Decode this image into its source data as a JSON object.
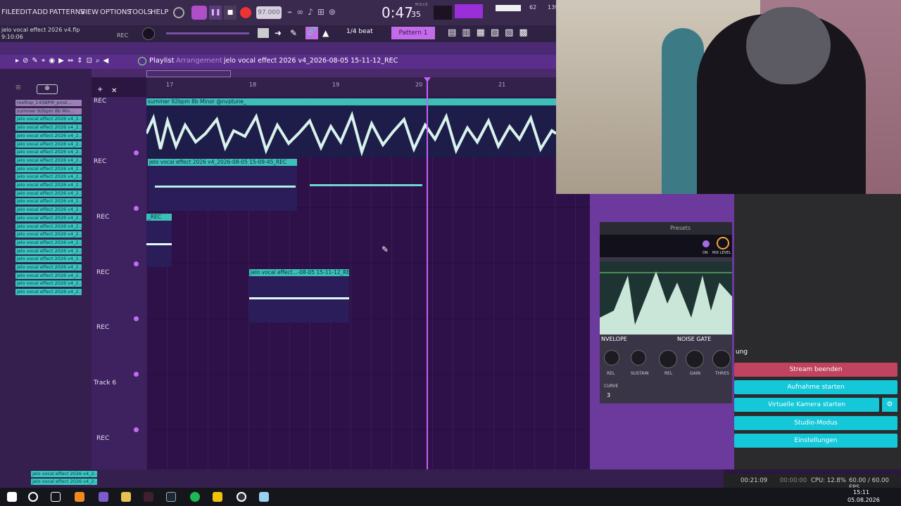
{
  "menu": [
    "FILE",
    "EDIT",
    "ADD",
    "PATTERNS",
    "VIEW",
    "OPTIONS",
    "TOOLS",
    "HELP"
  ],
  "transport": {
    "tempo": "97.000",
    "time": "0:47",
    "time_small": "35",
    "time_unit": "M:S:CS",
    "cpu_value": "62",
    "ram_value": "139"
  },
  "project": {
    "name": "jelo vocal effect 2026 v4.flp",
    "time": "9:10:06",
    "rec": "REC"
  },
  "snap": {
    "value": "1/4 beat",
    "pattern": "Pattern 1"
  },
  "playlist": {
    "title": "Playlist",
    "subtitle": "Arrangement",
    "clip_name": "jelo vocal effect 2026 v4_2026-08-05 15-11-12_REC"
  },
  "ruler": [
    "17",
    "18",
    "19",
    "20",
    "21"
  ],
  "patterns": [
    "rooftop_145BPM_prod...",
    "summer 92bpm 8b Min...",
    "jelo vocal effect 2026 v4_2...",
    "jelo vocal effect 2026 v4_2...",
    "jelo vocal effect 2026 v4_2...",
    "jelo vocal effect 2026 v4_2...",
    "jelo vocal effect 2026 v4_2...",
    "jelo vocal effect 2026 v4_2...",
    "jelo vocal effect 2026 v4_2...",
    "jelo vocal effect 2026 v4_2...",
    "jelo vocal effect 2026 v4_2...",
    "jelo vocal effect 2026 v4_2...",
    "jelo vocal effect 2026 v4_2...",
    "jelo vocal effect 2026 v4_2...",
    "jelo vocal effect 2026 v4_2...",
    "jelo vocal effect 2026 v4_2...",
    "jelo vocal effect 2026 v4_2...",
    "jelo vocal effect 2026 v4_2...",
    "jelo vocal effect 2026 v4_2...",
    "jelo vocal effect 2026 v4_2...",
    "jelo vocal effect 2026 v4_2...",
    "jelo vocal effect 2026 v4_2...",
    "jelo vocal effect 2026 v4_2...",
    "jelo vocal effect 2026 v4_2..."
  ],
  "tracks": [
    "REC",
    "REC",
    "REC",
    "REC",
    "REC",
    "Track 6",
    "REC"
  ],
  "clips": {
    "c1": "summer 92bpm 8b Minor @nvptune_",
    "c2": "jelo vocal effect 2026 v4_2026-08-05 15-09-45_REC",
    "c3": "_REC",
    "c4": "jelo vocal effect...-08-05 15-11-12_REC"
  },
  "plugin": {
    "presets": "Presets",
    "on": "ON",
    "mix": "MIX LEVEL",
    "envelope": "NVELOPE",
    "noise_gate": "NOISE GATE",
    "knobs": [
      "REL",
      "SUSTAIN",
      "REL",
      "GAIN",
      "THRES"
    ],
    "curve": "CURVE",
    "curve_val": "3"
  },
  "obs": {
    "dock_title": "ung",
    "buttons": [
      "Stream beenden",
      "Aufnahme starten",
      "Virtuelle Kamera starten",
      "Studio-Modus",
      "Einstellungen"
    ],
    "status": {
      "stream": "00:21:09",
      "rec": "00:00:00",
      "cpu": "CPU: 12.8%",
      "fps": "60.00 / 60.00 FPS"
    }
  },
  "bottom_clips": [
    "jelo vocal effect 2026 v4_2...",
    "jelo vocal effect 2026 v4_2..."
  ],
  "clock": {
    "time": "15:11",
    "date": "05.08.2026"
  },
  "colors": {
    "clip": "#3cbfb7",
    "accent": "#c561f5",
    "stream_end": "#c0435f",
    "obs_cyan": "#14c7d9"
  }
}
